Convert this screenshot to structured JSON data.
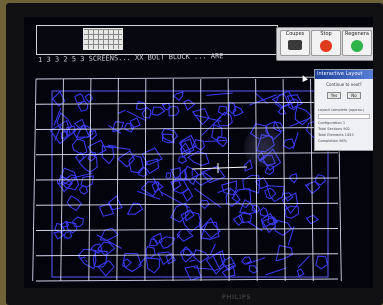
{
  "header": {
    "status_text": "1 3 3 2 5 3   SCREENS...   XX BOLT  BLOCK  ...  ARE"
  },
  "toolbar": {
    "buttons": [
      {
        "label": "Coupes",
        "icon": "program-icon"
      },
      {
        "label": "Stop",
        "icon": "stop-icon"
      },
      {
        "label": "Regenera",
        "icon": "go-icon"
      }
    ]
  },
  "dialog": {
    "title": "Interactive Layout",
    "message": "Continue to next?",
    "yes_label": "Yes",
    "no_label": "No",
    "info_lines": [
      "Layout complete (approx.)",
      "Configuration  1",
      "Total Sections  902",
      "Total Elements  1453",
      "Completion  98%"
    ]
  },
  "monitor": {
    "brand": "PHILIPS"
  },
  "colors": {
    "grid": "#e8ecff",
    "pattern": "#3c3cff",
    "screen_bg": "#04040c",
    "bezel": "#111114"
  }
}
